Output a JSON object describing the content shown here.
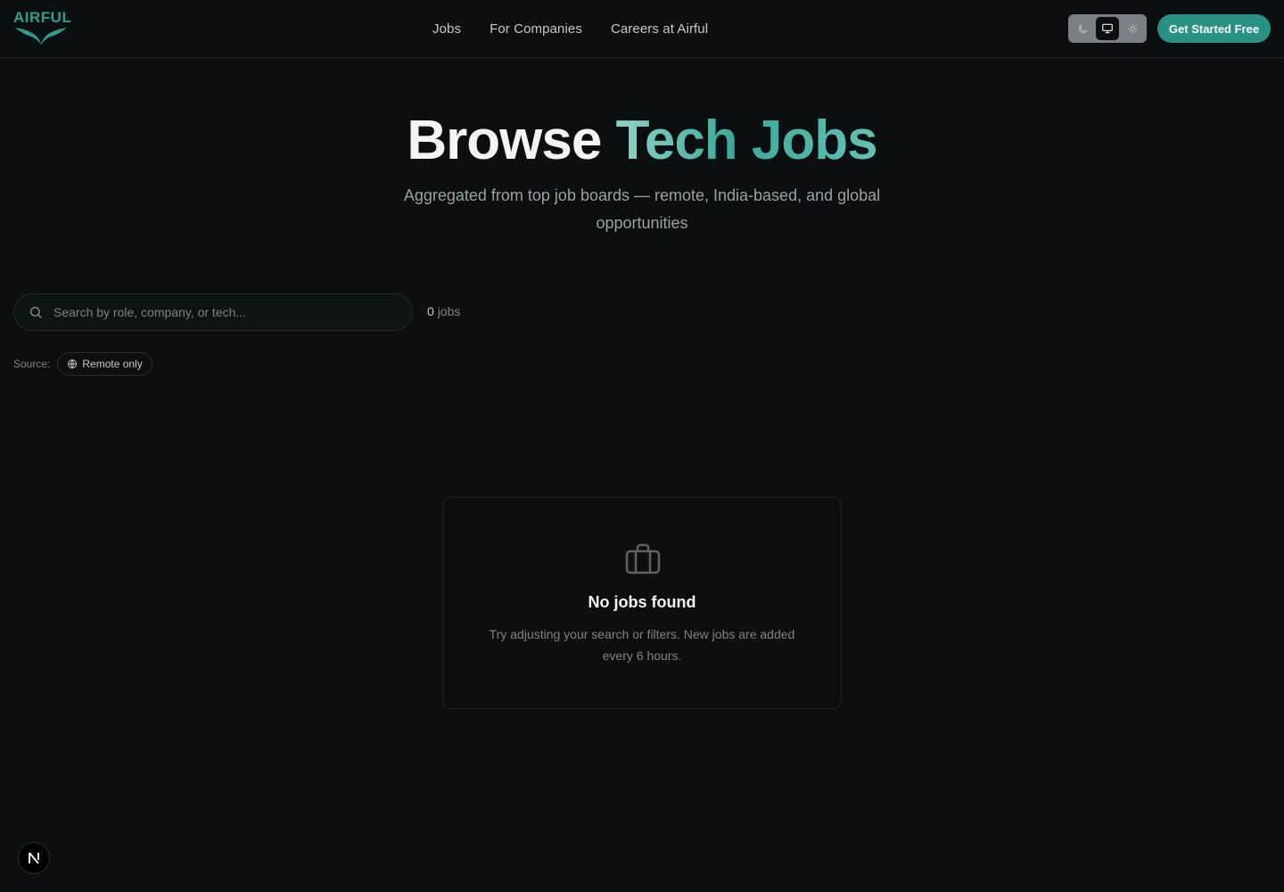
{
  "header": {
    "logo_text": "AIRFUL",
    "nav": [
      {
        "label": "Jobs"
      },
      {
        "label": "For Companies"
      },
      {
        "label": "Careers at Airful"
      }
    ],
    "theme_toggle": {
      "options": [
        "moon-icon",
        "monitor-icon",
        "sun-icon"
      ],
      "selected": "monitor-icon"
    },
    "cta_label": "Get Started Free"
  },
  "hero": {
    "title_part1": "Browse",
    "title_part2": "Tech Jobs",
    "subtitle": "Aggregated from top job boards — remote, India-based, and global opportunities"
  },
  "search": {
    "placeholder": "Search by role, company, or tech...",
    "value": ""
  },
  "results": {
    "count": "0",
    "count_label": "jobs"
  },
  "filters": {
    "source_label": "Source:",
    "chips": [
      {
        "label": "Remote only",
        "icon": "globe-icon"
      }
    ]
  },
  "empty_state": {
    "icon": "briefcase-icon",
    "title": "No jobs found",
    "text": "Try adjusting your search or filters. New jobs are added every 6 hours."
  },
  "floating_badge": {
    "label": "N"
  },
  "colors": {
    "background": "#0b0f0f",
    "accent": "#2a9186",
    "accent_light": "#8ed3c8"
  }
}
